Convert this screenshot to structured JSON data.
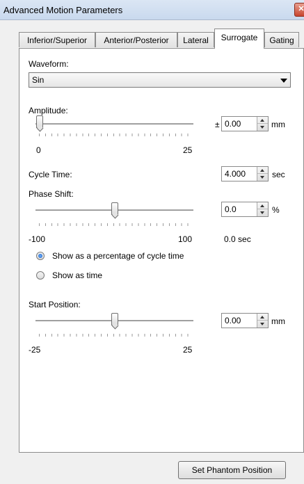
{
  "window": {
    "title": "Advanced Motion Parameters",
    "close_glyph": "✕"
  },
  "tabs": [
    {
      "label": "Inferior/Superior",
      "active": false
    },
    {
      "label": "Anterior/Posterior",
      "active": false
    },
    {
      "label": "Lateral",
      "active": false
    },
    {
      "label": "Surrogate",
      "active": true
    },
    {
      "label": "Gating",
      "active": false
    }
  ],
  "waveform": {
    "label": "Waveform:",
    "value": "Sin"
  },
  "amplitude": {
    "label": "Amplitude:",
    "prefix": "±",
    "value": "0.00",
    "unit": "mm",
    "min_label": "0",
    "max_label": "25",
    "slider_fraction": 0
  },
  "cycle_time": {
    "label": "Cycle Time:",
    "value": "4.000",
    "unit": "sec"
  },
  "phase_shift": {
    "label": "Phase Shift:",
    "value": "0.0",
    "unit": "%",
    "min_label": "-100",
    "max_label": "100",
    "time_readout": "0.0 sec",
    "slider_fraction": 0.5
  },
  "display_mode": {
    "options": [
      {
        "label": "Show as a percentage of cycle time",
        "selected": true
      },
      {
        "label": "Show as time",
        "selected": false
      }
    ]
  },
  "start_position": {
    "label": "Start Position:",
    "value": "0.00",
    "unit": "mm",
    "min_label": "-25",
    "max_label": "25",
    "slider_fraction": 0.5
  },
  "footer": {
    "set_phantom_label": "Set Phantom Position"
  }
}
